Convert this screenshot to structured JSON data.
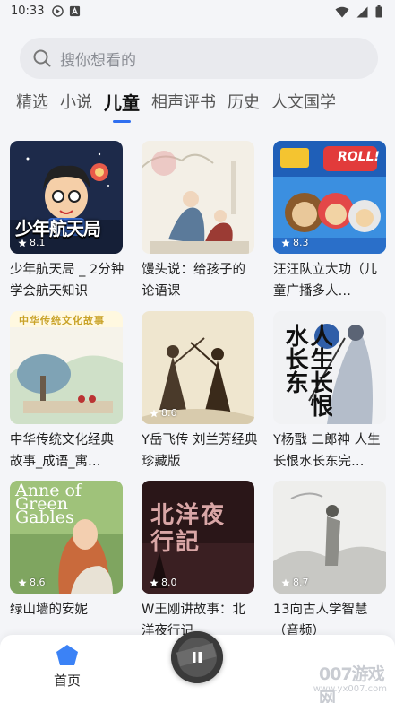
{
  "status_bar": {
    "time": "10:33"
  },
  "search": {
    "placeholder": "搜你想看的"
  },
  "tabs": [
    {
      "label": "精选"
    },
    {
      "label": "小说"
    },
    {
      "label": "儿童"
    },
    {
      "label": "相声评书"
    },
    {
      "label": "历史"
    },
    {
      "label": "人文国学"
    }
  ],
  "active_tab": "儿童",
  "books": [
    {
      "title": "少年航天局 _ 2分钟学会航天知识",
      "rating": "8.1",
      "cover_text": "少年航天局"
    },
    {
      "title": "馒头说：给孩子的论语课",
      "rating": "",
      "cover_text": ""
    },
    {
      "title": "汪汪队立大功（儿童广播多人…",
      "rating": "8.3",
      "cover_text": "ROLL!"
    },
    {
      "title": "中华传统文化经典故事_成语_寓…",
      "rating": "",
      "cover_text": "中华传统文化故事"
    },
    {
      "title": "Y岳飞传  刘兰芳经典珍藏版",
      "rating": "8.6",
      "cover_text": ""
    },
    {
      "title": "Y杨戬 二郎神 人生长恨水长东完…",
      "rating": "",
      "cover_text": "人生长恨水长东"
    },
    {
      "title": "绿山墙的安妮",
      "rating": "8.6",
      "cover_text": "Anne of Green Gables"
    },
    {
      "title": "W王刚讲故事：北洋夜行记",
      "rating": "8.0",
      "cover_text": "北洋夜行記"
    },
    {
      "title": "13向古人学智慧（音频）",
      "rating": "8.7",
      "cover_text": ""
    }
  ],
  "bottom_nav": {
    "home_label": "首页"
  },
  "watermark": {
    "main": "007游戏网",
    "sub": "www.yx007.com"
  },
  "colors": {
    "accent": "#2f6ff0",
    "background": "#f4f5f8"
  }
}
